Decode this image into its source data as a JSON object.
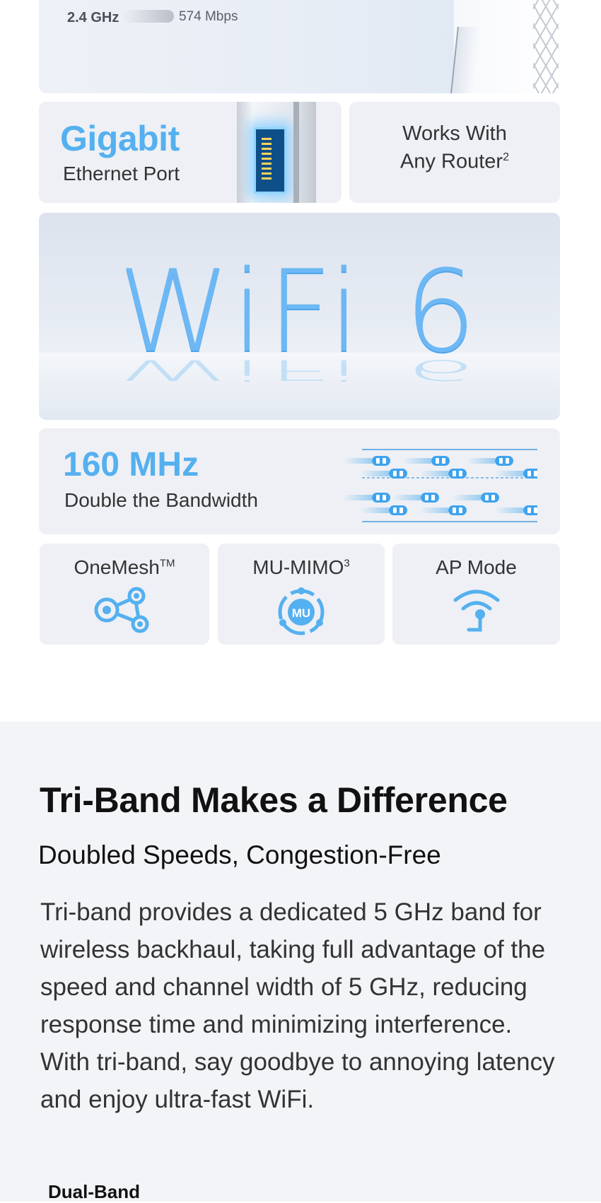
{
  "speed_card": {
    "band": "2.4 GHz",
    "speed": "574 Mbps"
  },
  "gigabit_card": {
    "title": "Gigabit",
    "subtitle": "Ethernet Port"
  },
  "router_card": {
    "line1": "Works With",
    "line2": "Any Router",
    "footnote": "2"
  },
  "wifi6_card": {
    "text": "WiFi 6"
  },
  "mhz_card": {
    "title": "160 MHz",
    "subtitle": "Double the  Bandwidth"
  },
  "features": [
    {
      "label": "OneMesh",
      "sup": "TM",
      "icon": "mesh-network-icon"
    },
    {
      "label": "MU-MIMO",
      "sup": "3",
      "icon": "mu-mimo-icon",
      "icon_text": "MU"
    },
    {
      "label": "AP Mode",
      "sup": "",
      "icon": "access-point-icon"
    }
  ],
  "section": {
    "title": "Tri-Band Makes a Difference",
    "subtitle": "Doubled Speeds, Congestion-Free",
    "body": "Tri-band provides a dedicated 5 GHz band for wireless backhaul, taking full advantage of the speed and channel width of 5 GHz, reducing response time and minimizing interference. With tri-band, say goodbye to annoying latency and enjoy ultra-fast WiFi.",
    "comparison_label": "Dual-Band"
  },
  "colors": {
    "accent": "#55b0ef",
    "card_bg": "#eef0f5",
    "section_bg": "#f3f4f7"
  }
}
